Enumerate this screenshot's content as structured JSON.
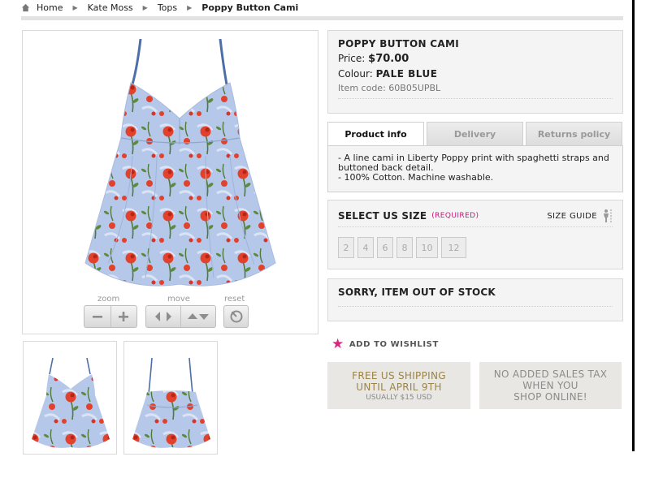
{
  "breadcrumb": {
    "home": "Home",
    "crumb1": "Kate Moss",
    "crumb2": "Tops",
    "current": "Poppy Button Cami"
  },
  "product": {
    "name": "POPPY BUTTON CAMI",
    "price_label": "Price:",
    "price": "$70.00",
    "colour_label": "Colour:",
    "colour": "PALE BLUE",
    "code_label": "Item code:",
    "code": "60B05UPBL"
  },
  "image_controls": {
    "zoom_label": "zoom",
    "move_label": "move",
    "reset_label": "reset"
  },
  "tabs": [
    {
      "label": "Product info",
      "active": true
    },
    {
      "label": "Delivery",
      "active": false
    },
    {
      "label": "Returns policy",
      "active": false
    }
  ],
  "description": {
    "line1": "- A line cami in Liberty Poppy print with spaghetti straps and buttoned back detail.",
    "line2": "- 100% Cotton. Machine washable."
  },
  "size": {
    "title": "SELECT US SIZE",
    "required": "(REQUIRED)",
    "guide": "SIZE GUIDE",
    "options": [
      "2",
      "4",
      "6",
      "8",
      "10",
      "12"
    ]
  },
  "stock": {
    "message": "SORRY, ITEM OUT OF STOCK"
  },
  "wishlist": {
    "label": "ADD TO WISHLIST"
  },
  "promos": {
    "shipping_line1": "FREE US SHIPPING",
    "shipping_line2": "UNTIL APRIL 9TH",
    "shipping_small": "USUALLY $15 USD",
    "tax_line1": "NO ADDED SALES TAX",
    "tax_line2": "WHEN YOU",
    "tax_line3": "SHOP ONLINE!"
  },
  "colors": {
    "accent_pink": "#e0237f",
    "promo_gold": "#9a8547",
    "promo_gray": "#8b8b8b",
    "fabric_blue": "#b4c7e8",
    "poppy_red": "#e2412c"
  },
  "icons": [
    "home-icon",
    "minus-icon",
    "plus-icon",
    "arrow-left-icon",
    "arrow-right-icon",
    "arrow-up-icon",
    "arrow-down-icon",
    "reset-icon",
    "figure-icon",
    "star-icon"
  ]
}
